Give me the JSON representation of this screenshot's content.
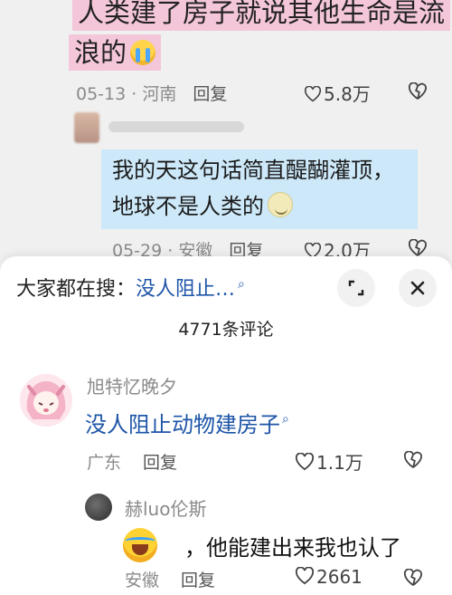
{
  "background_comment": {
    "text_line1": "人类建了房子就说其他生命是流",
    "text_line2": "浪的",
    "date": "05-13",
    "location": "河南",
    "reply_label": "回复",
    "likes": "5.8万"
  },
  "background_reply": {
    "text_line1": "我的天这句话简直醍醐灌顶，",
    "text_line2": "地球不是人类的",
    "date": "05-29",
    "location": "安徽",
    "reply_label": "回复",
    "likes": "2.0万"
  },
  "sheet": {
    "search_prefix": "大家都在搜：",
    "search_query": "没人阻止…",
    "comment_count": "4771条评论"
  },
  "comment": {
    "username": "旭特忆晚夕",
    "text": "没人阻止动物建房子",
    "location": "广东",
    "reply_label": "回复",
    "likes": "1.1万"
  },
  "reply": {
    "username": "赫luo伦斯",
    "text": "，他能建出来我也认了",
    "location": "安徽",
    "reply_label": "回复",
    "likes": "2661"
  },
  "colors": {
    "link_blue": "#1e55a8",
    "highlight_pink": "#f4c6d9",
    "highlight_blue": "#cde8f8"
  },
  "icons": [
    "heart-icon",
    "broken-heart-icon",
    "search-icon",
    "collapse-icon",
    "close-icon",
    "crying-emoji",
    "laughing-crying-emoji"
  ]
}
